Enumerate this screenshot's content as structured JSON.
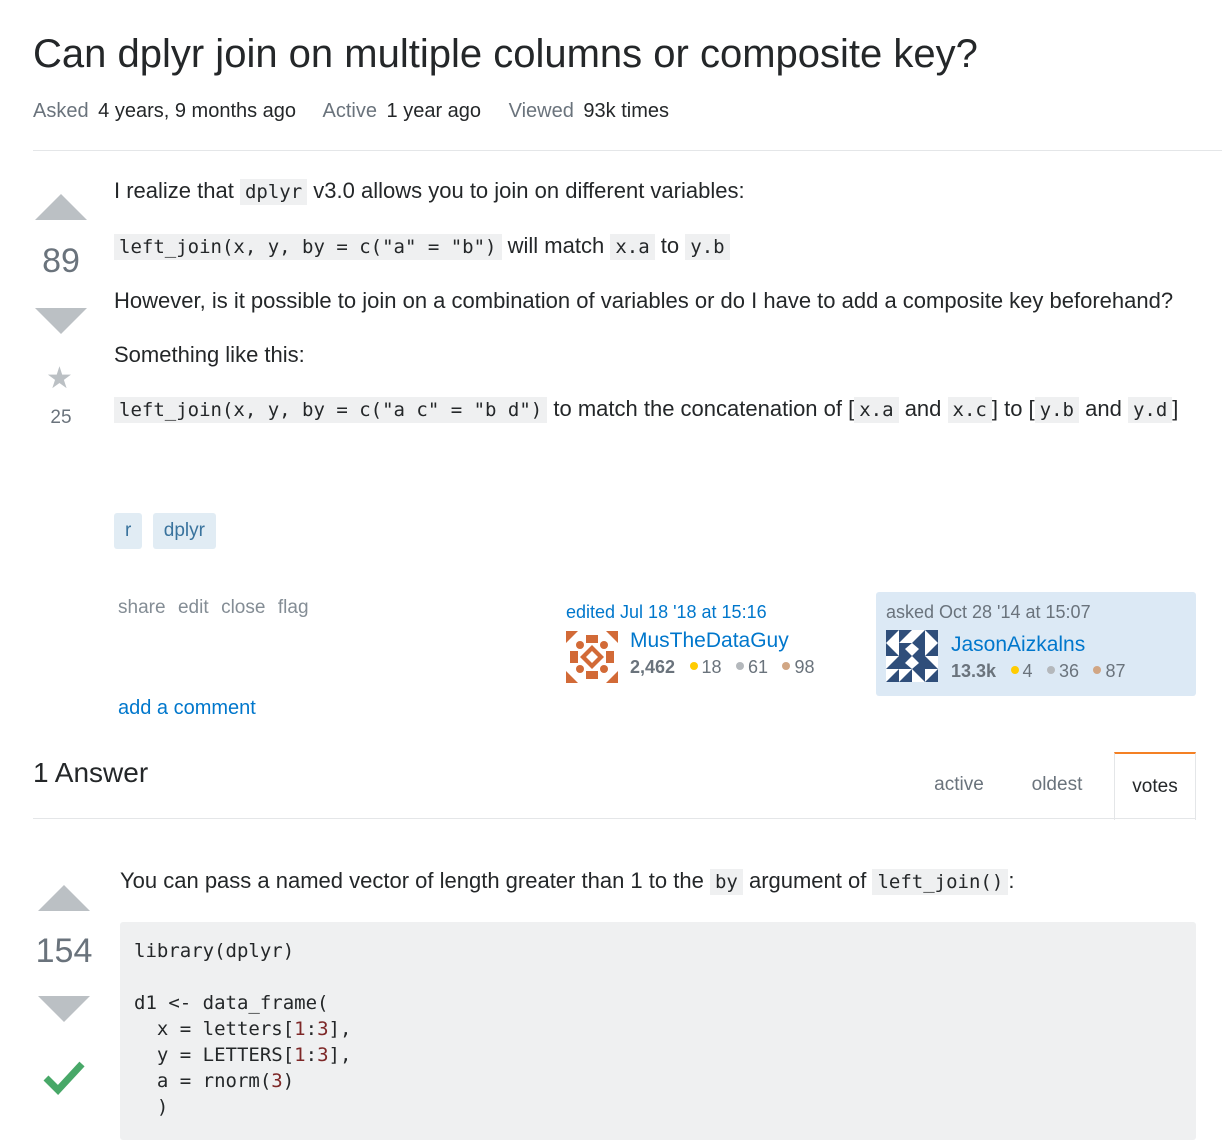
{
  "question": {
    "title": "Can dplyr join on multiple columns or composite key?",
    "meta": {
      "asked_label": "Asked",
      "asked_value": "4 years, 9 months ago",
      "active_label": "Active",
      "active_value": "1 year ago",
      "viewed_label": "Viewed",
      "viewed_value": "93k times"
    },
    "score": "89",
    "favorites": "25",
    "body": {
      "p1_a": "I realize that",
      "p1_code": "dplyr",
      "p1_b": "v3.0 allows you to join on different variables:",
      "p2_code1": "left_join(x, y, by = c(\"a\" = \"b\")",
      "p2_a": "will match",
      "p2_code2": "x.a",
      "p2_b": "to",
      "p2_code3": "y.b",
      "p3": "However, is it possible to join on a combination of variables or do I have to add a composite key beforehand?",
      "p4": "Something like this:",
      "p5_code1": "left_join(x, y, by = c(\"a c\" = \"b d\")",
      "p5_a": "to match the concatenation of [",
      "p5_code2": "x.a",
      "p5_b": "and",
      "p5_code3": "x.c",
      "p5_c": "] to [",
      "p5_code4": "y.b",
      "p5_d": "and",
      "p5_code5": "y.d",
      "p5_e": "]"
    },
    "tags": [
      "r",
      "dplyr"
    ],
    "menu": [
      "share",
      "edit",
      "close",
      "flag"
    ],
    "edited": {
      "time": "edited Jul 18 '18 at 15:16",
      "user": "MusTheDataGuy",
      "rep": "2,462",
      "gold": "18",
      "silver": "61",
      "bronze": "98"
    },
    "asked": {
      "time": "asked Oct 28 '14 at 15:07",
      "user": "JasonAizkalns",
      "rep": "13.3k",
      "gold": "4",
      "silver": "36",
      "bronze": "87"
    },
    "add_comment": "add a comment"
  },
  "answers_header": {
    "count_label": "1 Answer",
    "tabs": [
      "active",
      "oldest",
      "votes"
    ],
    "active_tab": "votes"
  },
  "answer": {
    "score": "154",
    "intro_a": "You can pass a named vector of length greater than 1 to the",
    "intro_code1": "by",
    "intro_b": "argument of",
    "intro_code2": "left_join()",
    "intro_c": ":"
  },
  "colors": {
    "link": "#0077cc",
    "accent_orange": "#f48024",
    "accepted_green": "#48a868",
    "badge_gold": "#ffcc01",
    "badge_silver": "#b4b8bc",
    "badge_bronze": "#d1a684",
    "owner_card_bg": "#dce9f5",
    "tag_bg": "#e1ecf4"
  }
}
